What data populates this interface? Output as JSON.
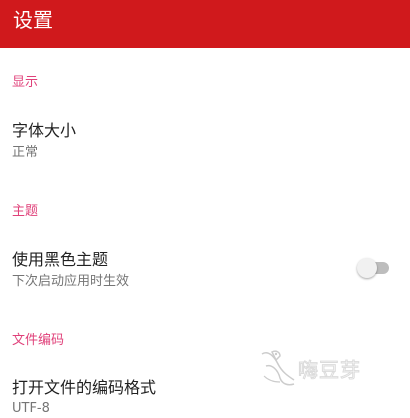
{
  "app_bar": {
    "title": "设置",
    "background_color": "#d0191c"
  },
  "accent_color": "#e0417a",
  "sections": [
    {
      "header": "显示",
      "items": [
        {
          "title": "字体大小",
          "summary": "正常"
        }
      ]
    },
    {
      "header": "主题",
      "items": [
        {
          "title": "使用黑色主题",
          "summary": "下次启动应用时生效",
          "switch_on": false
        }
      ]
    },
    {
      "header": "文件编码",
      "items": [
        {
          "title": "打开文件的编码格式",
          "summary": "UTF-8"
        }
      ]
    }
  ],
  "watermark": {
    "text": "嗨豆芽",
    "icon": "bird-logo-icon"
  }
}
